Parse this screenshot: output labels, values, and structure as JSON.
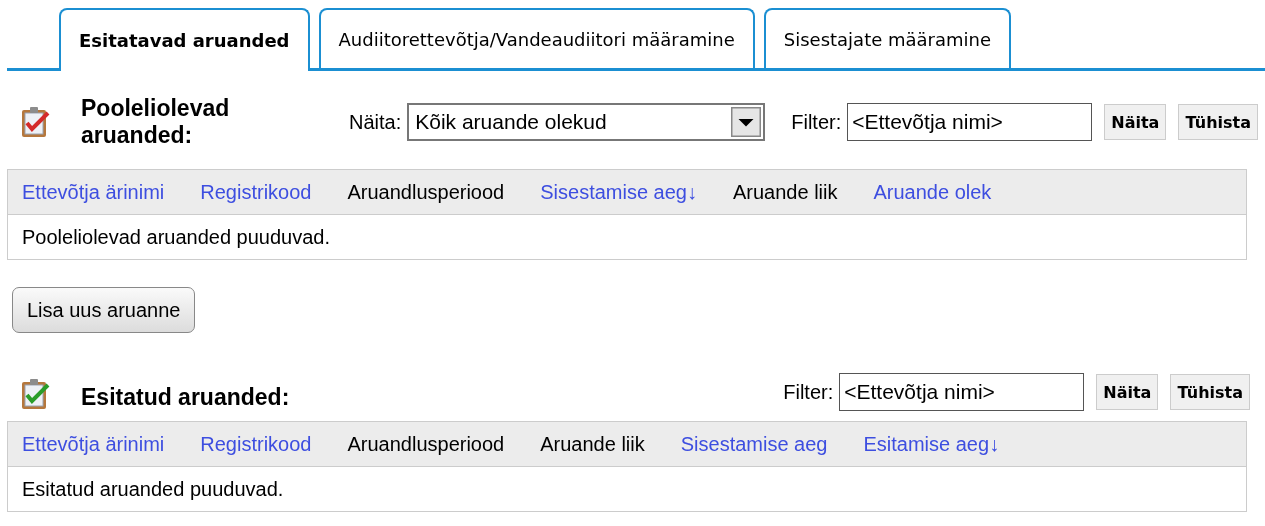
{
  "tabs": [
    {
      "label": "Esitatavad aruanded",
      "selected": true
    },
    {
      "label": "Audiitorettevõtja/Vandeaudiitori määramine",
      "selected": false
    },
    {
      "label": "Sisestajate määramine",
      "selected": false
    }
  ],
  "sections": [
    {
      "title": "Pooleliolevad aruanded:",
      "color": "#d42a2a",
      "show": {
        "label": "Näita:",
        "value": "Kõik aruande olekud"
      },
      "filter": {
        "label": "Filter:",
        "value": "<Ettevõtja nimi>"
      },
      "buttons": [
        "Näita",
        "Tühista"
      ],
      "columns": [
        {
          "label": "Ettevõtja ärinimi",
          "kind": "link"
        },
        {
          "label": "Registrikood",
          "kind": "link"
        },
        {
          "label": "Aruandlusperiood",
          "kind": "plain"
        },
        {
          "label": "Sisestamise aeg",
          "kind": "link",
          "sort_arrow": "↓"
        },
        {
          "label": "Aruande liik",
          "kind": "plain"
        },
        {
          "label": "Aruande olek",
          "kind": "link"
        }
      ],
      "empty_message": "Pooleliolevad aruanded puuduvad.",
      "action_button": "Lisa uus aruanne"
    },
    {
      "title": "Esitatud aruanded:",
      "color": "#2a9d2a",
      "filter": {
        "label": "Filter:",
        "value": "<Ettevõtja nimi>"
      },
      "buttons": [
        "Näita",
        "Tühista"
      ],
      "columns": [
        {
          "label": "Ettevõtja ärinimi",
          "kind": "link"
        },
        {
          "label": "Registrikood",
          "kind": "link"
        },
        {
          "label": "Aruandlusperiood",
          "kind": "plain"
        },
        {
          "label": "Aruande liik",
          "kind": "plain"
        },
        {
          "label": "Sisestamise aeg",
          "kind": "link"
        },
        {
          "label": "Esitamise aeg",
          "kind": "link",
          "sort_arrow": "↓"
        }
      ],
      "empty_message": "Esitatud aruanded puuduvad."
    }
  ]
}
